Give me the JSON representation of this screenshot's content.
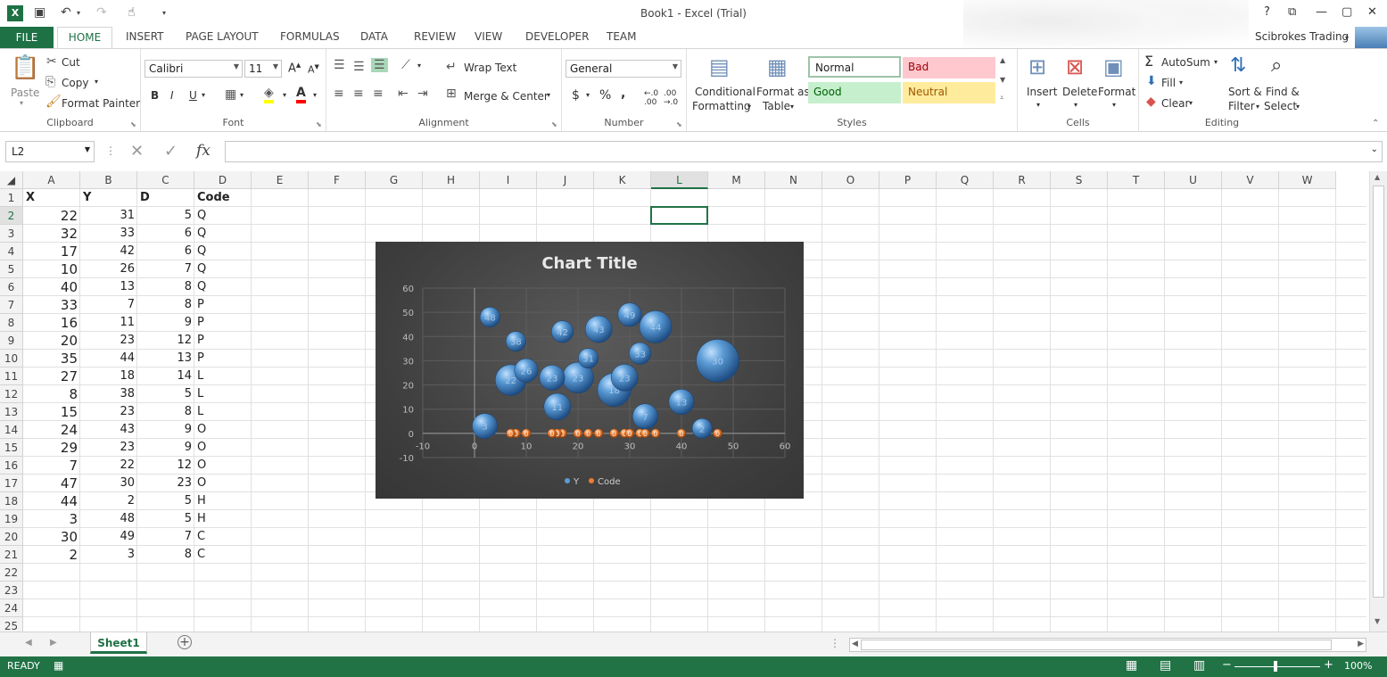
{
  "window": {
    "title": "Book1 - Excel (Trial)",
    "help": "?",
    "minimize": "—",
    "restore": "▢",
    "close": "✕"
  },
  "tabs": [
    "FILE",
    "HOME",
    "INSERT",
    "PAGE LAYOUT",
    "FORMULAS",
    "DATA",
    "REVIEW",
    "VIEW",
    "DEVELOPER",
    "TEAM"
  ],
  "user": {
    "name": "Scibrokes Trading"
  },
  "ribbon": {
    "clipboard": {
      "paste": "Paste",
      "cut": "Cut",
      "copy": "Copy",
      "format_painter": "Format Painter",
      "label": "Clipboard"
    },
    "font": {
      "name": "Calibri",
      "size": "11",
      "label": "Font",
      "bold": "B",
      "italic": "I",
      "underline": "U"
    },
    "alignment": {
      "wrap": "Wrap Text",
      "merge": "Merge & Center",
      "label": "Alignment"
    },
    "number": {
      "format": "General",
      "label": "Number",
      "currency": "$",
      "percent": "%",
      "comma": ","
    },
    "styles": {
      "conditional_1": "Conditional",
      "conditional_2": "Formatting",
      "format_table_1": "Format as",
      "format_table_2": "Table",
      "normal": "Normal",
      "bad": "Bad",
      "good": "Good",
      "neutral": "Neutral",
      "label": "Styles"
    },
    "cells": {
      "insert": "Insert",
      "delete": "Delete",
      "format": "Format",
      "label": "Cells"
    },
    "editing": {
      "autosum": "AutoSum",
      "fill": "Fill",
      "clear": "Clear",
      "sort_1": "Sort &",
      "sort_2": "Filter",
      "find_1": "Find &",
      "find_2": "Select",
      "label": "Editing"
    }
  },
  "formula_bar": {
    "name_box": "L2",
    "fx": "fx",
    "value": ""
  },
  "columns": [
    "A",
    "B",
    "C",
    "D",
    "E",
    "F",
    "G",
    "H",
    "I",
    "J",
    "K",
    "L",
    "M",
    "N",
    "O",
    "P",
    "Q",
    "R",
    "S",
    "T",
    "U",
    "V",
    "W"
  ],
  "rows": [
    "1",
    "2",
    "3",
    "4",
    "5",
    "6",
    "7",
    "8",
    "9",
    "10",
    "11",
    "12",
    "13",
    "14",
    "15",
    "16",
    "17",
    "18",
    "19",
    "20",
    "21",
    "22",
    "23",
    "24",
    "25"
  ],
  "headers": [
    "X",
    "Y",
    "D",
    "Code"
  ],
  "table": [
    [
      22,
      31,
      5,
      "Q"
    ],
    [
      32,
      33,
      6,
      "Q"
    ],
    [
      17,
      42,
      6,
      "Q"
    ],
    [
      10,
      26,
      7,
      "Q"
    ],
    [
      40,
      13,
      8,
      "Q"
    ],
    [
      33,
      7,
      8,
      "P"
    ],
    [
      16,
      11,
      9,
      "P"
    ],
    [
      20,
      23,
      12,
      "P"
    ],
    [
      35,
      44,
      13,
      "P"
    ],
    [
      27,
      18,
      14,
      "L"
    ],
    [
      8,
      38,
      5,
      "L"
    ],
    [
      15,
      23,
      8,
      "L"
    ],
    [
      24,
      43,
      9,
      "O"
    ],
    [
      29,
      23,
      9,
      "O"
    ],
    [
      7,
      22,
      12,
      "O"
    ],
    [
      47,
      30,
      23,
      "O"
    ],
    [
      44,
      2,
      5,
      "H"
    ],
    [
      3,
      48,
      5,
      "H"
    ],
    [
      30,
      49,
      7,
      "C"
    ],
    [
      2,
      3,
      8,
      "C"
    ]
  ],
  "chart_data": {
    "type": "scatter",
    "title": "Chart Title",
    "xlabel": "",
    "ylabel": "",
    "xlim": [
      -10,
      60
    ],
    "ylim": [
      -10,
      60
    ],
    "xticks": [
      -10,
      0,
      10,
      20,
      30,
      40,
      50,
      60
    ],
    "yticks": [
      -10,
      0,
      10,
      20,
      30,
      40,
      50,
      60
    ],
    "grid": true,
    "legend": "bottom",
    "series": [
      {
        "name": "Y",
        "color": "#5b9bd5",
        "x": [
          22,
          32,
          17,
          10,
          40,
          33,
          16,
          20,
          35,
          27,
          8,
          15,
          24,
          29,
          7,
          47,
          44,
          3,
          30,
          2
        ],
        "y": [
          31,
          33,
          42,
          26,
          13,
          7,
          11,
          23,
          44,
          18,
          38,
          23,
          43,
          23,
          22,
          30,
          2,
          48,
          49,
          3
        ],
        "size": [
          5,
          6,
          6,
          7,
          8,
          8,
          9,
          12,
          13,
          14,
          5,
          8,
          9,
          9,
          12,
          23,
          5,
          5,
          7,
          8
        ]
      },
      {
        "name": "Code",
        "color": "#ed7d31",
        "x": [
          22,
          32,
          17,
          10,
          40,
          33,
          16,
          20,
          35,
          27,
          8,
          15,
          24,
          29,
          7,
          47,
          44,
          3,
          30,
          2
        ],
        "y": [
          0,
          0,
          0,
          0,
          0,
          0,
          0,
          0,
          0,
          0,
          0,
          0,
          0,
          0,
          0,
          0,
          0,
          0,
          0,
          0
        ],
        "label": "0"
      }
    ]
  },
  "sheet": {
    "tab": "Sheet1",
    "add": "+"
  },
  "status": {
    "mode": "READY",
    "zoom": "100%"
  }
}
